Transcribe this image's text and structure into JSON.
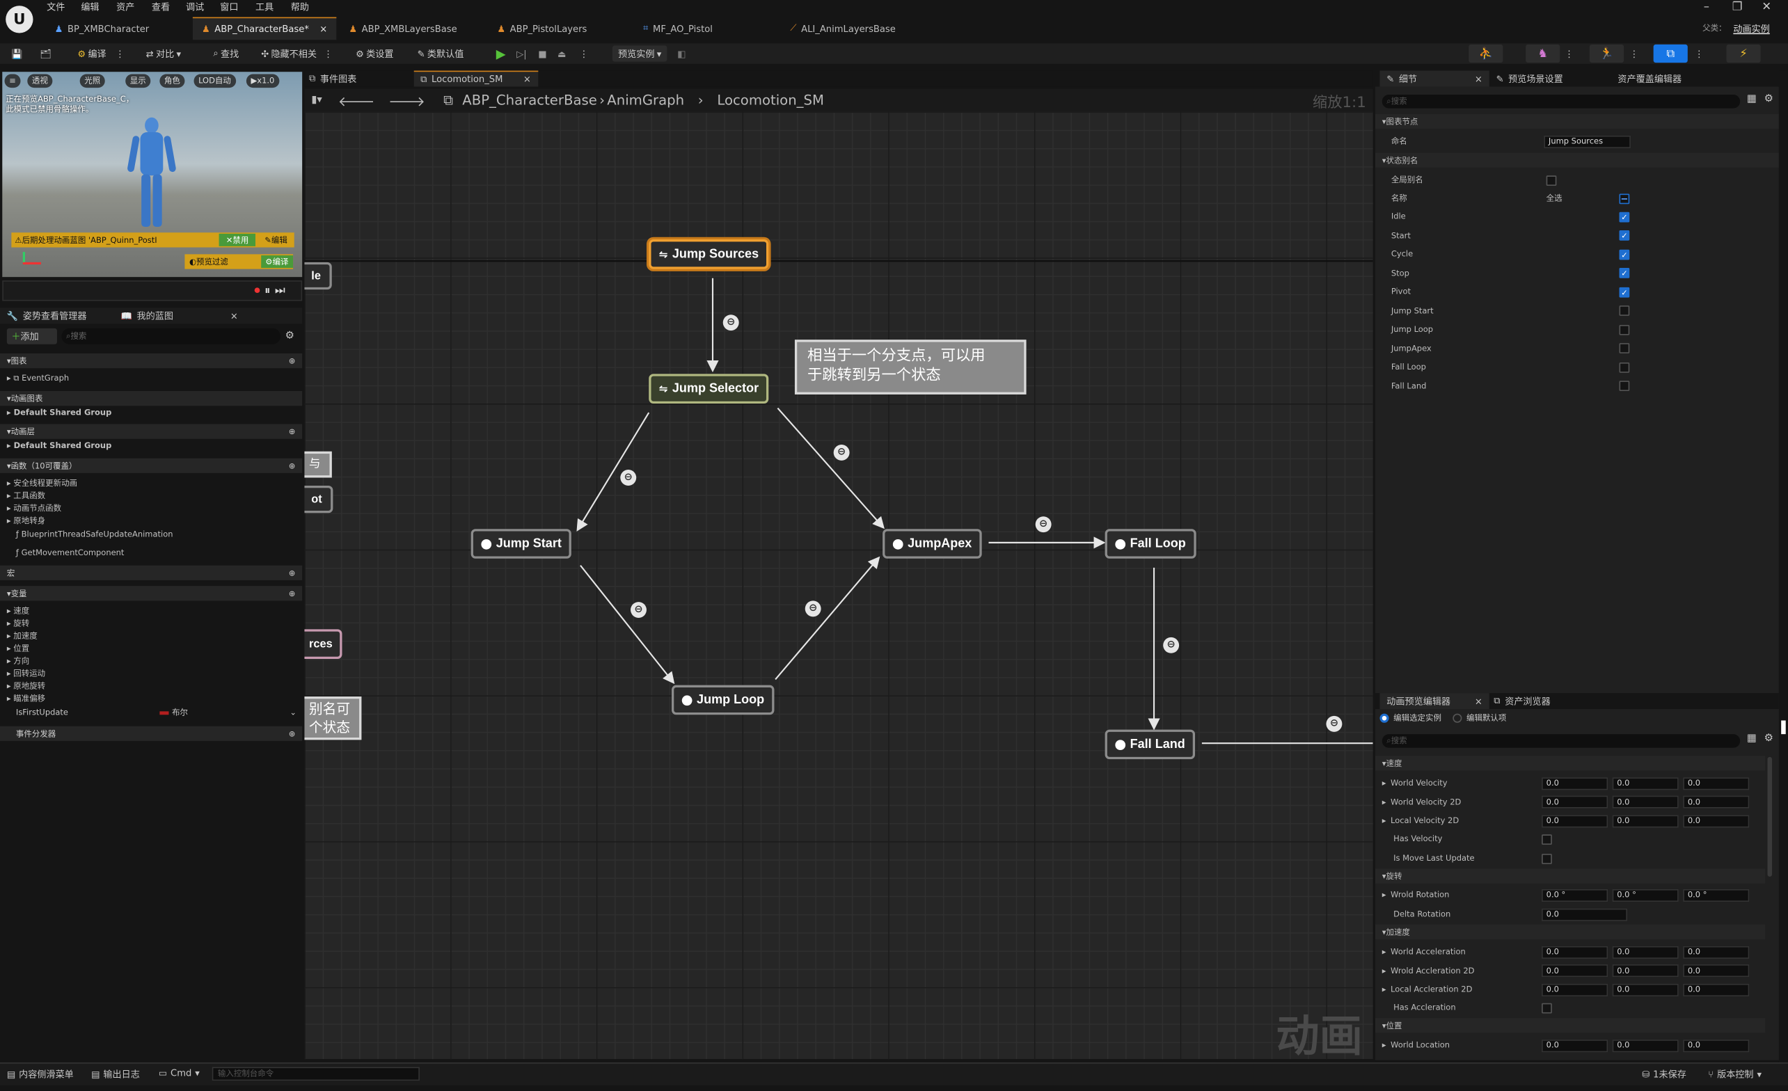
{
  "menu": [
    "文件",
    "编辑",
    "资产",
    "查看",
    "调试",
    "窗口",
    "工具",
    "帮助"
  ],
  "tabs": [
    "BP_XMBCharacter",
    "ABP_CharacterBase*",
    "ABP_XMBLayersBase",
    "ABP_PistolLayers",
    "MF_AO_Pistol",
    "ALI_AnimLayersBase"
  ],
  "title_right": {
    "parent_label": "父类：",
    "parent_value": "动画实例"
  },
  "toolbar": {
    "compile": "编译",
    "diff": "对比",
    "find": "查找",
    "hide_unrelated": "隐藏不相关",
    "class_settings": "类设置",
    "class_defaults": "类默认值",
    "preview": "预览实例"
  },
  "viewport": {
    "buttons": [
      "透视",
      "光照",
      "显示",
      "角色",
      "LOD自动",
      "x1.0"
    ],
    "info_line1": "正在预览ABP_CharacterBase_C，",
    "info_line2": "此模式已禁用骨骼操作。",
    "warning": "后期处理动画蓝图 'ABP_Quinn_PostI",
    "disable": "禁用",
    "edit": "编辑",
    "preview_filter": "预览过滤",
    "compile": "编译"
  },
  "left_tabs": {
    "pose_watch": "姿势查看管理器",
    "my_blueprint": "我的蓝图"
  },
  "mybp": {
    "add": "添加",
    "search_placeholder": "搜索",
    "graphs": "图表",
    "event_graph": "EventGraph",
    "anim_graphs": "动画图表",
    "default_group1": "Default Shared Group",
    "anim_layers": "动画层",
    "default_group2": "Default Shared Group",
    "functions": "函数（10可覆盖）",
    "func_items": [
      "安全线程更新动画",
      "工具函数",
      "动画节点函数",
      "原地转身"
    ],
    "func_fns": [
      "BlueprintThreadSafeUpdateAnimation",
      "GetMovementComponent"
    ],
    "macros": "宏",
    "variables": "变量",
    "var_groups": [
      "速度",
      "旋转",
      "加速度",
      "位置",
      "方向",
      "回转运动",
      "原地旋转",
      "瞄准偏移"
    ],
    "var_name": "IsFirstUpdate",
    "var_type": "布尔",
    "dispatchers": "事件分发器"
  },
  "graph_tabs": {
    "event_graph": "事件图表",
    "locomotion": "Locomotion_SM"
  },
  "breadcrumb": {
    "root": "ABP_CharacterBase",
    "anim_graph": "AnimGraph",
    "current": "Locomotion_SM",
    "zoom": "缩放1:1"
  },
  "nodes": {
    "jump_sources": "Jump Sources",
    "jump_selector": "Jump Selector",
    "jump_start": "Jump Start",
    "jump_apex": "JumpApex",
    "jump_loop": "Jump Loop",
    "fall_loop": "Fall Loop",
    "fall_land": "Fall Land"
  },
  "comments": {
    "main_line1": "相当于一个分支点，可以用",
    "main_line2": "于跳转到另一个状态",
    "left1": "le",
    "left2": "与",
    "left3": "ot",
    "left4": "rces",
    "left5_line1": "别名可",
    "left5_line2": "个状态"
  },
  "watermark": "动画",
  "details": {
    "tabs": [
      "细节",
      "预览场景设置",
      "资产覆盖编辑器"
    ],
    "search_placeholder": "搜索",
    "graph_node": "图表节点",
    "name_label": "命名",
    "name_value": "Jump Sources",
    "state_alias": "状态别名",
    "global_alias": "全局别名",
    "name_col": "名称",
    "select_all": "全选",
    "states": [
      {
        "name": "Idle",
        "checked": true
      },
      {
        "name": "Start",
        "checked": true
      },
      {
        "name": "Cycle",
        "checked": true
      },
      {
        "name": "Stop",
        "checked": true
      },
      {
        "name": "Pivot",
        "checked": true
      },
      {
        "name": "Jump Start",
        "checked": false
      },
      {
        "name": "Jump Loop",
        "checked": false
      },
      {
        "name": "JumpApex",
        "checked": false
      },
      {
        "name": "Fall Loop",
        "checked": false
      },
      {
        "name": "Fall Land",
        "checked": false
      }
    ]
  },
  "anim_preview": {
    "tabs": [
      "动画预览编辑器",
      "资产浏览器"
    ],
    "edit_instance": "编辑选定实例",
    "edit_defaults": "编辑默认项",
    "search_placeholder": "搜索",
    "cat_velocity": "速度",
    "cat_rotation": "旋转",
    "cat_accel": "加速度",
    "cat_location": "位置",
    "rows_velocity": [
      {
        "name": "World Velocity",
        "v": [
          "0.0",
          "0.0",
          "0.0"
        ]
      },
      {
        "name": "World Velocity 2D",
        "v": [
          "0.0",
          "0.0",
          "0.0"
        ]
      },
      {
        "name": "Local Velocity 2D",
        "v": [
          "0.0",
          "0.0",
          "0.0"
        ]
      }
    ],
    "has_velocity": "Has Velocity",
    "is_move_last": "Is Move Last Update",
    "world_rotation": "Wrold Rotation",
    "rot_values": [
      "0.0 °",
      "0.0 °",
      "0.0 °"
    ],
    "delta_rotation": "Delta Rotation",
    "delta_value": "0.0",
    "rows_accel": [
      {
        "name": "World Acceleration",
        "v": [
          "0.0",
          "0.0",
          "0.0"
        ]
      },
      {
        "name": "Wrold Accleration 2D",
        "v": [
          "0.0",
          "0.0",
          "0.0"
        ]
      },
      {
        "name": "Local Accleration 2D",
        "v": [
          "0.0",
          "0.0",
          "0.0"
        ]
      }
    ],
    "has_accel": "Has Accleration",
    "world_location": "World Location",
    "loc_values": [
      "0.0",
      "0.0",
      "0.0"
    ]
  },
  "status": {
    "content_drawer": "内容侧滑菜单",
    "output_log": "输出日志",
    "cmd": "Cmd",
    "cmd_placeholder": "输入控制台命令",
    "unsaved": "1未保存",
    "version": "版本控制"
  },
  "colors": {
    "accent": "#d0801a",
    "node_border": "#8c8c8c",
    "selected": "#f0a030",
    "checkbox": "#1f6fd0"
  }
}
